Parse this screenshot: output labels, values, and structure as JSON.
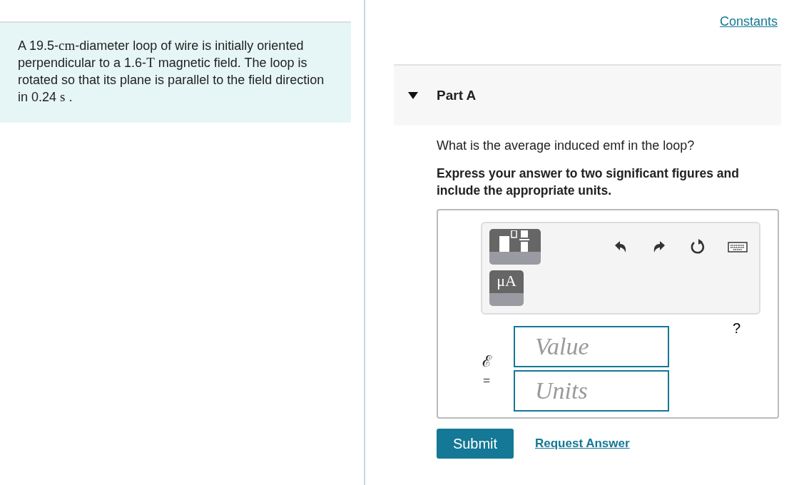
{
  "problem": [
    {
      "kind": "text",
      "text": "A 19.5-"
    },
    {
      "kind": "unit",
      "text": "cm"
    },
    {
      "kind": "text",
      "text": "-diameter loop of wire is initially oriented perpendicular to a 1.6-"
    },
    {
      "kind": "unit",
      "text": "T"
    },
    {
      "kind": "text",
      "text": " magnetic field. The loop is rotated so that its plane is parallel to the field direction in 0.24 "
    },
    {
      "kind": "unit",
      "text": "s"
    },
    {
      "kind": "text",
      "text": " ."
    }
  ],
  "constants_link": "Constants",
  "part": {
    "title": "Part A",
    "expanded": true,
    "question": "What is the average induced emf in the loop?",
    "instruction": "Express your answer to two significant figures and include the appropriate units.",
    "toolbar": {
      "units_button": "μA",
      "help": "?"
    },
    "symbol": "ℰ",
    "equals": "=",
    "value_field": {
      "placeholder": "Value"
    },
    "units_field": {
      "placeholder": "Units"
    },
    "submit": "Submit",
    "request_answer": "Request Answer"
  }
}
